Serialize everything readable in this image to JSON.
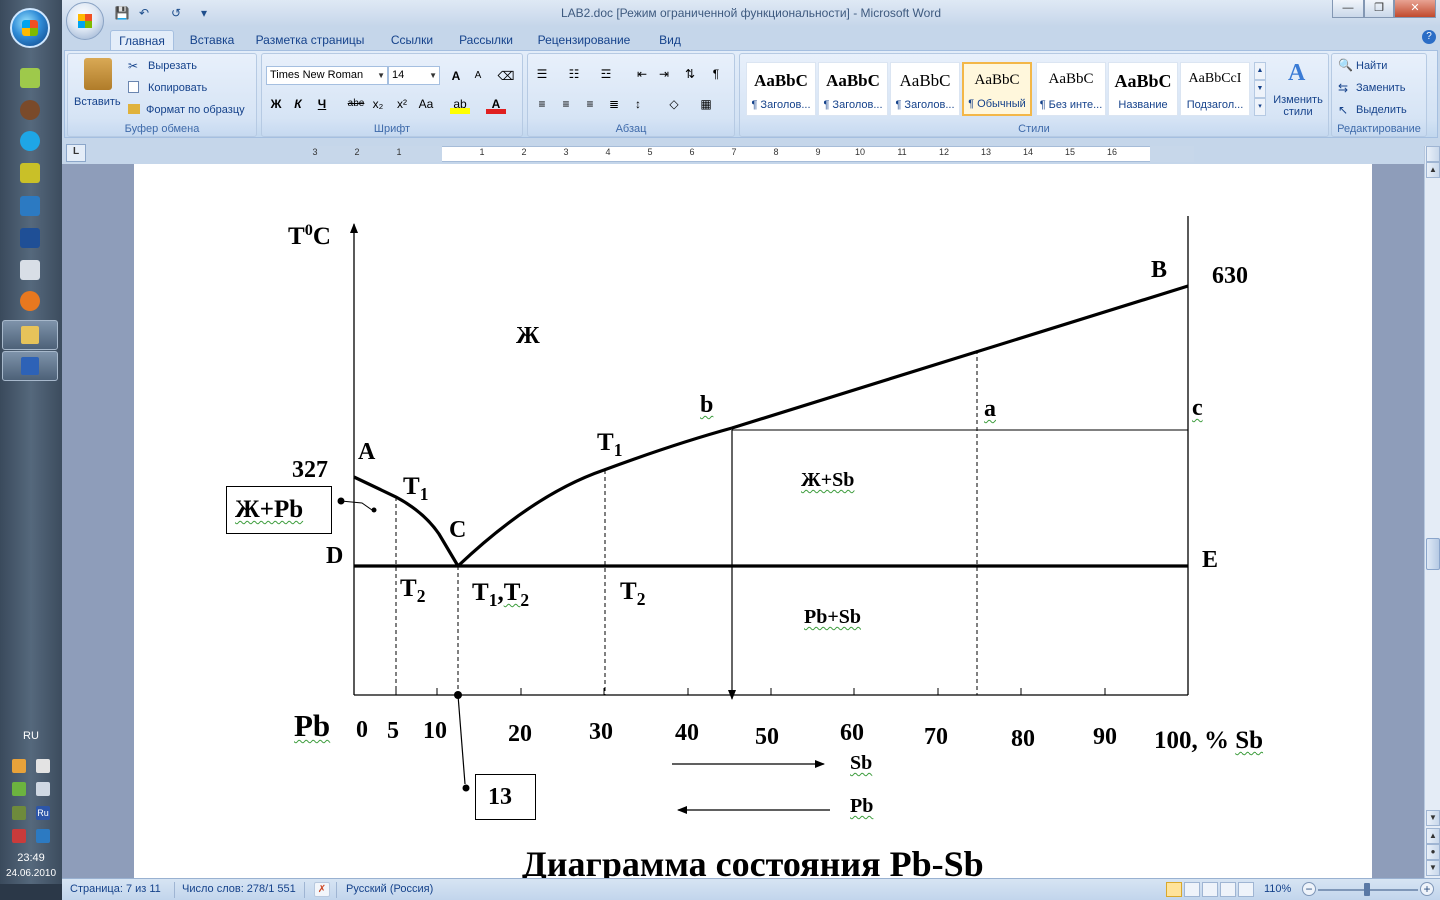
{
  "taskbar": {
    "language": "RU",
    "time": "23:49",
    "date": "24.06.2010",
    "tray_lang_badge": "Ru"
  },
  "window": {
    "title": "LAB2.doc [Режим ограниченной функциональности] - Microsoft Word",
    "qat": {
      "save": "💾",
      "undo": "↶",
      "redo": "↺",
      "more": "▾"
    },
    "controls": {
      "minimize": "—",
      "maximize": "❐",
      "close": "✕"
    }
  },
  "ribbon": {
    "tabs": [
      "Главная",
      "Вставка",
      "Разметка страницы",
      "Ссылки",
      "Рассылки",
      "Рецензирование",
      "Вид"
    ],
    "clipboard": {
      "paste": "Вставить",
      "cut": "Вырезать",
      "copy": "Копировать",
      "format_painter": "Формат по образцу",
      "label": "Буфер обмена"
    },
    "font": {
      "family": "Times New Roman",
      "size": "14",
      "label": "Шрифт",
      "bold": "Ж",
      "italic": "К",
      "underline": "Ч",
      "strike": "abe",
      "subscript": "x₂",
      "superscript": "x²",
      "case": "Aa",
      "grow": "A",
      "shrink": "A"
    },
    "paragraph": {
      "label": "Абзац",
      "pilcrow": "¶"
    },
    "styles": {
      "label": "Стили",
      "items": [
        {
          "sample": "AaBbC",
          "name": "¶ Заголов..."
        },
        {
          "sample": "AaBbC",
          "name": "¶ Заголов..."
        },
        {
          "sample": "AaBbC",
          "name": "¶ Заголов..."
        },
        {
          "sample": "AaBbC",
          "name": "¶ Обычный"
        },
        {
          "sample": "AaBbC",
          "name": "¶ Без инте..."
        },
        {
          "sample": "AaBbC",
          "name": "Название"
        },
        {
          "sample": "AaBbCcI",
          "name": "Подзагол..."
        }
      ],
      "change_styles": "Изменить стили"
    },
    "editing": {
      "label": "Редактирование",
      "find": "Найти",
      "replace": "Заменить",
      "select": "Выделить"
    }
  },
  "ruler": {
    "numbers": [
      "3",
      "2",
      "1",
      "1",
      "2",
      "3",
      "4",
      "5",
      "6",
      "7",
      "8",
      "9",
      "10",
      "11",
      "12",
      "13",
      "14",
      "15",
      "16"
    ]
  },
  "diagram": {
    "title": "Диаграмма состояния Pb-Sb",
    "y_axis_label": "T",
    "y_axis_label_sup": "0",
    "y_axis_label_unit": "C",
    "points": {
      "A": "A",
      "B": "B",
      "C": "C",
      "D": "D",
      "E": "E",
      "a": "a",
      "b": "b",
      "c": "c"
    },
    "values": {
      "t_pb": "327",
      "t_sb": "630"
    },
    "regions": {
      "liquid": "Ж",
      "liquid_sb": "Ж+Sb",
      "pb_sb": "Pb+Sb",
      "liquid_pb": "Ж+Pb"
    },
    "t_labels": {
      "t": "T",
      "one": "1",
      "two": "2",
      "comma": ",",
      "t1_left": "T1",
      "t2_left": "T2",
      "t1t2": "T1,T2",
      "t1_mid": "T1",
      "t2_mid": "T2"
    },
    "x_ticks": [
      "0",
      "5",
      "10",
      "20",
      "30",
      "40",
      "50",
      "60",
      "70",
      "80",
      "90"
    ],
    "x_end_num": "100, % ",
    "x_end_unit": "Sb",
    "x_origin_label": "Pb",
    "eutectic_label": "13",
    "arrow_sb": "Sb",
    "arrow_pb": "Pb"
  },
  "statusbar": {
    "page": "Страница: 7 из 11",
    "words": "Число слов: 278/1 551",
    "language": "Русский (Россия)",
    "zoom": "110%",
    "zoom_minus": "−",
    "zoom_plus": "+"
  },
  "colors": {
    "ribbon_bg": "#dbe7f6",
    "accent_text": "#15428b",
    "active_style_border": "#f3b748",
    "page_bg": "#ffffff"
  }
}
